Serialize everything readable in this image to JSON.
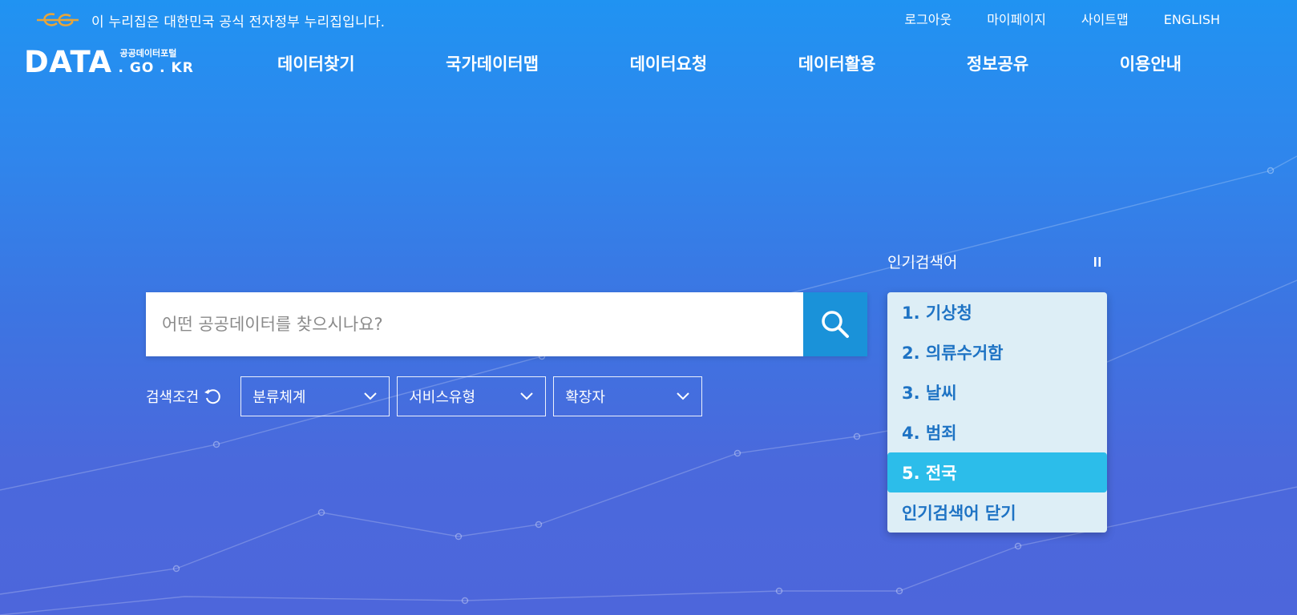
{
  "gov_banner": {
    "logo_icon": "egov-symbol-icon",
    "text": "이 누리집은 대한민국 공식 전자정부 누리집입니다."
  },
  "top_links": [
    {
      "label": "로그아웃"
    },
    {
      "label": "마이페이지"
    },
    {
      "label": "사이트맵"
    },
    {
      "label": "ENGLISH"
    }
  ],
  "logo": {
    "main": "DATA",
    "subtitle": "공공데이터포털",
    "domain": ". GO . KR"
  },
  "nav": [
    {
      "label": "데이터찾기"
    },
    {
      "label": "국가데이터맵"
    },
    {
      "label": "데이터요청"
    },
    {
      "label": "데이터활용"
    },
    {
      "label": "정보공유"
    },
    {
      "label": "이용안내"
    }
  ],
  "search": {
    "placeholder": "어떤 공공데이터를 찾으시나요?",
    "button_icon": "search-icon",
    "button_color": "#1a92d9"
  },
  "filters": {
    "label": "검색조건",
    "reset_icon": "refresh-icon",
    "selects": [
      {
        "label": "분류체계"
      },
      {
        "label": "서비스유형"
      },
      {
        "label": "확장자"
      }
    ]
  },
  "popular": {
    "title": "인기검색어",
    "control_icon": "pause-icon",
    "items": [
      {
        "label": "1. 기상청"
      },
      {
        "label": "2. 의류수거함"
      },
      {
        "label": "3. 날씨"
      },
      {
        "label": "4. 범죄"
      },
      {
        "label": "5. 전국"
      }
    ],
    "active_index": 4,
    "active_color": "#2cbdea",
    "close_label": "인기검색어 닫기"
  },
  "colors": {
    "background_top": "#2093f2",
    "background_bottom": "#4d66db",
    "popular_bg": "#ddeef6",
    "popular_text": "#1e73c4"
  }
}
